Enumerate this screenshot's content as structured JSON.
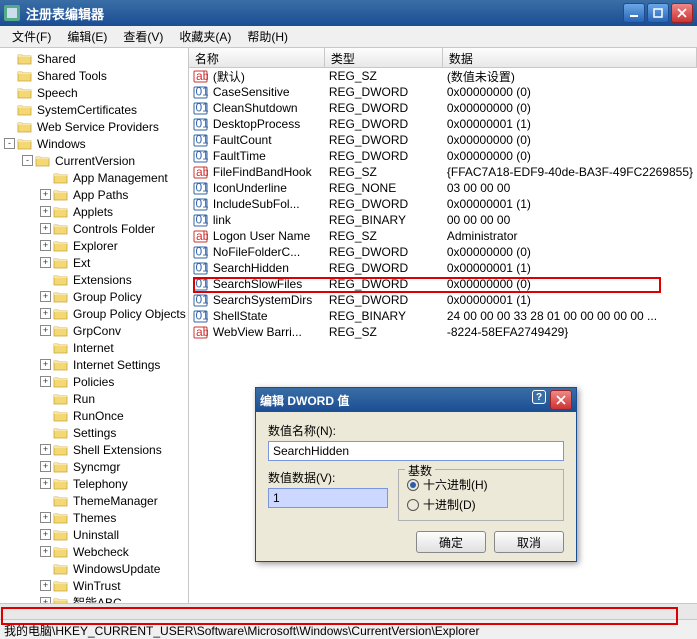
{
  "title": "注册表编辑器",
  "window_buttons": {
    "min": "minimize",
    "max": "restore",
    "close": "close"
  },
  "menu": [
    "文件(F)",
    "编辑(E)",
    "查看(V)",
    "收藏夹(A)",
    "帮助(H)"
  ],
  "tree": {
    "root": [
      {
        "label": "Shared",
        "exp": "none",
        "indent": 0
      },
      {
        "label": "Shared Tools",
        "exp": "none",
        "indent": 0
      },
      {
        "label": "Speech",
        "exp": "none",
        "indent": 0
      },
      {
        "label": "SystemCertificates",
        "exp": "none",
        "indent": 0
      },
      {
        "label": "Web Service Providers",
        "exp": "none",
        "indent": 0
      },
      {
        "label": "Windows",
        "exp": "-",
        "indent": 0
      },
      {
        "label": "CurrentVersion",
        "exp": "-",
        "indent": 1
      },
      {
        "label": "App Management",
        "exp": "none",
        "indent": 2
      },
      {
        "label": "App Paths",
        "exp": "+",
        "indent": 2
      },
      {
        "label": "Applets",
        "exp": "+",
        "indent": 2
      },
      {
        "label": "Controls Folder",
        "exp": "+",
        "indent": 2
      },
      {
        "label": "Explorer",
        "exp": "+",
        "indent": 2
      },
      {
        "label": "Ext",
        "exp": "+",
        "indent": 2
      },
      {
        "label": "Extensions",
        "exp": "none",
        "indent": 2
      },
      {
        "label": "Group Policy",
        "exp": "+",
        "indent": 2
      },
      {
        "label": "Group Policy Objects",
        "exp": "+",
        "indent": 2
      },
      {
        "label": "GrpConv",
        "exp": "+",
        "indent": 2
      },
      {
        "label": "Internet",
        "exp": "none",
        "indent": 2
      },
      {
        "label": "Internet Settings",
        "exp": "+",
        "indent": 2
      },
      {
        "label": "Policies",
        "exp": "+",
        "indent": 2
      },
      {
        "label": "Run",
        "exp": "none",
        "indent": 2
      },
      {
        "label": "RunOnce",
        "exp": "none",
        "indent": 2
      },
      {
        "label": "Settings",
        "exp": "none",
        "indent": 2
      },
      {
        "label": "Shell Extensions",
        "exp": "+",
        "indent": 2
      },
      {
        "label": "Syncmgr",
        "exp": "+",
        "indent": 2
      },
      {
        "label": "Telephony",
        "exp": "+",
        "indent": 2
      },
      {
        "label": "ThemeManager",
        "exp": "none",
        "indent": 2
      },
      {
        "label": "Themes",
        "exp": "+",
        "indent": 2
      },
      {
        "label": "Uninstall",
        "exp": "+",
        "indent": 2
      },
      {
        "label": "Webcheck",
        "exp": "+",
        "indent": 2
      },
      {
        "label": "WindowsUpdate",
        "exp": "none",
        "indent": 2
      },
      {
        "label": "WinTrust",
        "exp": "+",
        "indent": 2
      },
      {
        "label": "智能ABC",
        "exp": "+",
        "indent": 2
      }
    ]
  },
  "columns": {
    "name": "名称",
    "type": "类型",
    "data": "数据"
  },
  "rows": [
    {
      "icon": "sz",
      "name": "(默认)",
      "type": "REG_SZ",
      "data": "(数值未设置)"
    },
    {
      "icon": "dw",
      "name": "CaseSensitive",
      "type": "REG_DWORD",
      "data": "0x00000000 (0)"
    },
    {
      "icon": "dw",
      "name": "CleanShutdown",
      "type": "REG_DWORD",
      "data": "0x00000000 (0)"
    },
    {
      "icon": "dw",
      "name": "DesktopProcess",
      "type": "REG_DWORD",
      "data": "0x00000001 (1)"
    },
    {
      "icon": "dw",
      "name": "FaultCount",
      "type": "REG_DWORD",
      "data": "0x00000000 (0)"
    },
    {
      "icon": "dw",
      "name": "FaultTime",
      "type": "REG_DWORD",
      "data": "0x00000000 (0)"
    },
    {
      "icon": "sz",
      "name": "FileFindBandHook",
      "type": "REG_SZ",
      "data": "{FFAC7A18-EDF9-40de-BA3F-49FC2269855}"
    },
    {
      "icon": "dw",
      "name": "IconUnderline",
      "type": "REG_NONE",
      "data": "03 00 00 00"
    },
    {
      "icon": "dw",
      "name": "IncludeSubFol...",
      "type": "REG_DWORD",
      "data": "0x00000001 (1)"
    },
    {
      "icon": "dw",
      "name": "link",
      "type": "REG_BINARY",
      "data": "00 00 00 00"
    },
    {
      "icon": "sz",
      "name": "Logon User Name",
      "type": "REG_SZ",
      "data": "Administrator"
    },
    {
      "icon": "dw",
      "name": "NoFileFolderC...",
      "type": "REG_DWORD",
      "data": "0x00000000 (0)"
    },
    {
      "icon": "dw",
      "name": "SearchHidden",
      "type": "REG_DWORD",
      "data": "0x00000001 (1)"
    },
    {
      "icon": "dw",
      "name": "SearchSlowFiles",
      "type": "REG_DWORD",
      "data": "0x00000000 (0)"
    },
    {
      "icon": "dw",
      "name": "SearchSystemDirs",
      "type": "REG_DWORD",
      "data": "0x00000001 (1)"
    },
    {
      "icon": "dw",
      "name": "ShellState",
      "type": "REG_BINARY",
      "data": "24 00 00 00 33 28 01 00 00 00 00 00 ..."
    },
    {
      "icon": "sz",
      "name": "WebView Barri...",
      "type": "REG_SZ",
      "data": "-8224-58EFA2749429}"
    }
  ],
  "dialog": {
    "title": "编辑 DWORD 值",
    "name_label": "数值名称(N):",
    "name_value": "SearchHidden",
    "data_label": "数值数据(V):",
    "data_value": "1",
    "base_label": "基数",
    "hex_label": "十六进制(H)",
    "dec_label": "十进制(D)",
    "ok": "确定",
    "cancel": "取消"
  },
  "statusbar": "我的电脑\\HKEY_CURRENT_USER\\Software\\Microsoft\\Windows\\CurrentVersion\\Explorer"
}
